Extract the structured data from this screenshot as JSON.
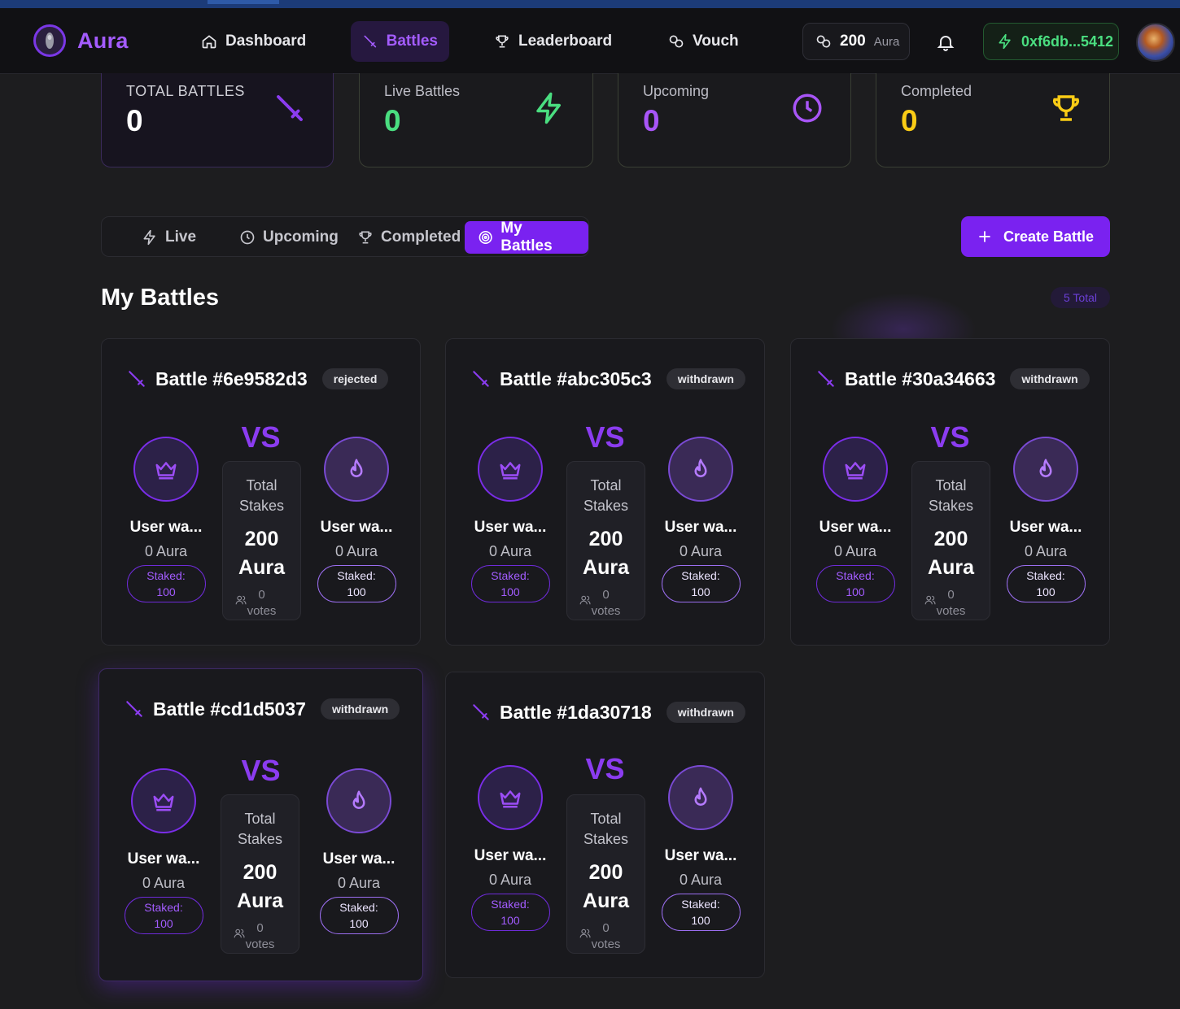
{
  "brand": {
    "name": "Aura"
  },
  "nav": {
    "items": [
      {
        "label": "Dashboard",
        "icon": "home-icon"
      },
      {
        "label": "Battles",
        "icon": "sword-icon",
        "active": true
      },
      {
        "label": "Leaderboard",
        "icon": "trophy-icon"
      },
      {
        "label": "Vouch",
        "icon": "link-icon"
      }
    ],
    "balance": {
      "amount": "200",
      "unit": "Aura"
    },
    "wallet": "0xf6db...5412"
  },
  "stats": [
    {
      "label": "TOTAL BATTLES",
      "value": "0",
      "color": "#ffffff",
      "icon": "sword-icon"
    },
    {
      "label": "Live Battles",
      "value": "0",
      "color": "#4ade80",
      "icon": "bolt-icon"
    },
    {
      "label": "Upcoming",
      "value": "0",
      "color": "#a855f7",
      "icon": "clock-icon"
    },
    {
      "label": "Completed",
      "value": "0",
      "color": "#facc15",
      "icon": "trophy-icon"
    }
  ],
  "tabs": [
    {
      "label": "Live",
      "icon": "bolt-icon"
    },
    {
      "label": "Upcoming",
      "icon": "clock-icon"
    },
    {
      "label": "Completed",
      "icon": "trophy-icon"
    },
    {
      "label": "My Battles",
      "icon": "target-icon",
      "active": true
    }
  ],
  "create_button": "Create Battle",
  "section": {
    "title": "My Battles",
    "total": "5 Total"
  },
  "battle_labels": {
    "vs": "VS",
    "total_stakes": "Total Stakes",
    "staked": "Staked:",
    "votes_label": "votes"
  },
  "battles": [
    {
      "title": "Battle #6e9582d3",
      "status": "rejected",
      "stakes": "200 Aura",
      "votes": "0",
      "left": {
        "name": "User wa...",
        "aura": "0 Aura",
        "staked": "100"
      },
      "right": {
        "name": "User wa...",
        "aura": "0 Aura",
        "staked": "100"
      }
    },
    {
      "title": "Battle #abc305c3",
      "status": "withdrawn",
      "stakes": "200 Aura",
      "votes": "0",
      "left": {
        "name": "User wa...",
        "aura": "0 Aura",
        "staked": "100"
      },
      "right": {
        "name": "User wa...",
        "aura": "0 Aura",
        "staked": "100"
      }
    },
    {
      "title": "Battle #30a34663",
      "status": "withdrawn",
      "stakes": "200 Aura",
      "votes": "0",
      "left": {
        "name": "User wa...",
        "aura": "0 Aura",
        "staked": "100"
      },
      "right": {
        "name": "User wa...",
        "aura": "0 Aura",
        "staked": "100"
      }
    },
    {
      "title": "Battle #cd1d5037",
      "status": "withdrawn",
      "stakes": "200 Aura",
      "votes": "0",
      "left": {
        "name": "User wa...",
        "aura": "0 Aura",
        "staked": "100"
      },
      "right": {
        "name": "User wa...",
        "aura": "0 Aura",
        "staked": "100"
      }
    },
    {
      "title": "Battle #1da30718",
      "status": "withdrawn",
      "stakes": "200 Aura",
      "votes": "0",
      "left": {
        "name": "User wa...",
        "aura": "0 Aura",
        "staked": "100"
      },
      "right": {
        "name": "User wa...",
        "aura": "0 Aura",
        "staked": "100"
      }
    }
  ]
}
